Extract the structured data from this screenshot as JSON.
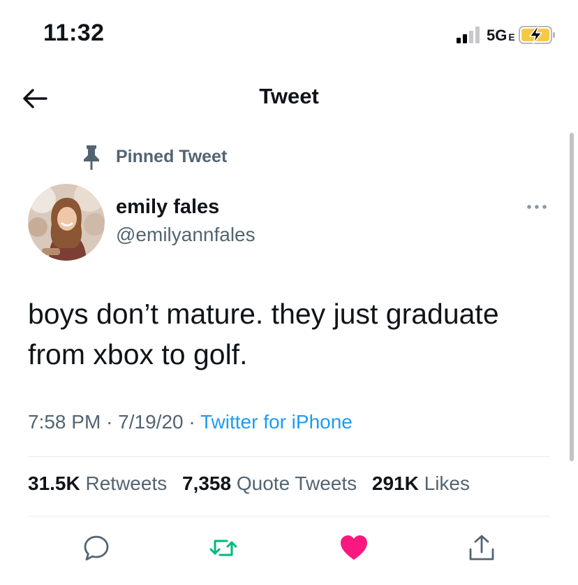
{
  "status_bar": {
    "time": "11:32",
    "network": "5G",
    "network_suffix": "E",
    "battery_color": "#f7c844"
  },
  "header": {
    "title": "Tweet",
    "back_icon": "arrow-left-icon"
  },
  "tweet": {
    "pinned_label": "Pinned Tweet",
    "author_name": "emily fales",
    "author_handle": "@emilyannfales",
    "text_line1": "boys don’t mature. they just graduate",
    "text_line2": "from xbox to golf.",
    "time": "7:58 PM",
    "date": "7/19/20",
    "separator": "·",
    "source": "Twitter for iPhone"
  },
  "stats": {
    "retweets_count": "31.5K",
    "retweets_label": "Retweets",
    "quotes_count": "7,358",
    "quotes_label": "Quote Tweets",
    "likes_count": "291K",
    "likes_label": "Likes"
  },
  "actions": {
    "reply_icon": "reply-icon",
    "retweet_icon": "retweet-icon",
    "like_icon": "heart-icon",
    "share_icon": "share-icon"
  },
  "colors": {
    "accent": "#1d9bf0",
    "retweet": "#00ba7c",
    "like": "#f91880",
    "secondary_text": "#536471"
  }
}
